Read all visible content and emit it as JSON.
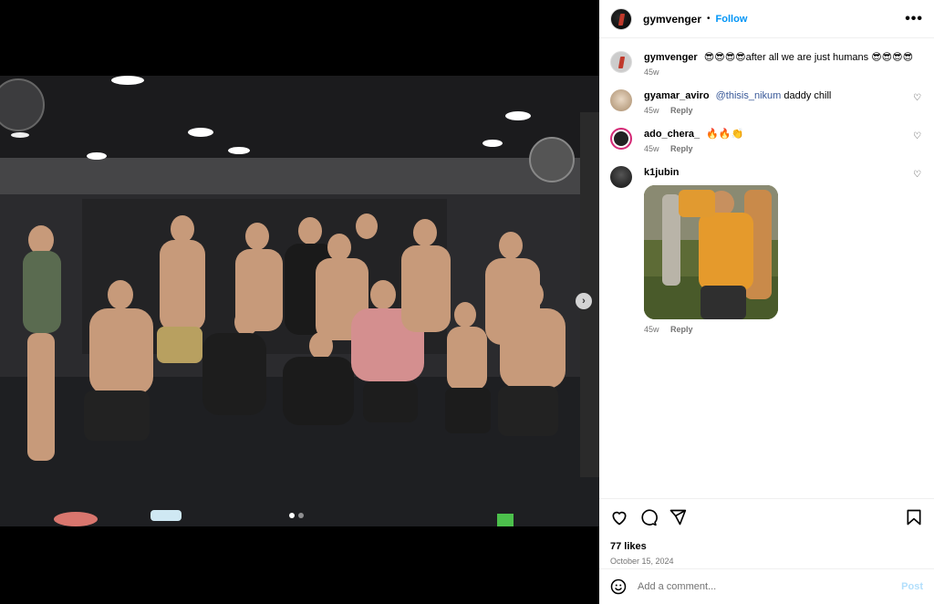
{
  "header": {
    "username": "gymvenger",
    "separator": "•",
    "follow_label": "Follow",
    "more_label": "•••"
  },
  "media": {
    "next_label": "›",
    "carousel_dots": 2
  },
  "caption": {
    "username": "gymvenger",
    "text": "😎😎😎😎after all we are just humans 😎😎😎😎",
    "time": "45w"
  },
  "comments": [
    {
      "username": "gyamar_aviro",
      "mention": "@thisis_nikum",
      "text": "daddy chill",
      "time": "45w",
      "reply_label": "Reply"
    },
    {
      "username": "ado_chera_",
      "mention": "",
      "text": "🔥🔥👏",
      "time": "45w",
      "reply_label": "Reply"
    },
    {
      "username": "k1jubin",
      "mention": "",
      "text": "",
      "time": "45w",
      "reply_label": "Reply"
    }
  ],
  "post": {
    "likes": "77 likes",
    "date": "October 15, 2024"
  },
  "composer": {
    "placeholder": "Add a comment...",
    "post_label": "Post"
  },
  "icons": {
    "like": "heart-icon",
    "comment": "comment-icon",
    "share": "send-icon",
    "save": "bookmark-icon",
    "emoji": "emoji-icon"
  },
  "colors": {
    "link_blue": "#0095f6",
    "muted": "#737373",
    "post_disabled": "#b2dffc"
  }
}
